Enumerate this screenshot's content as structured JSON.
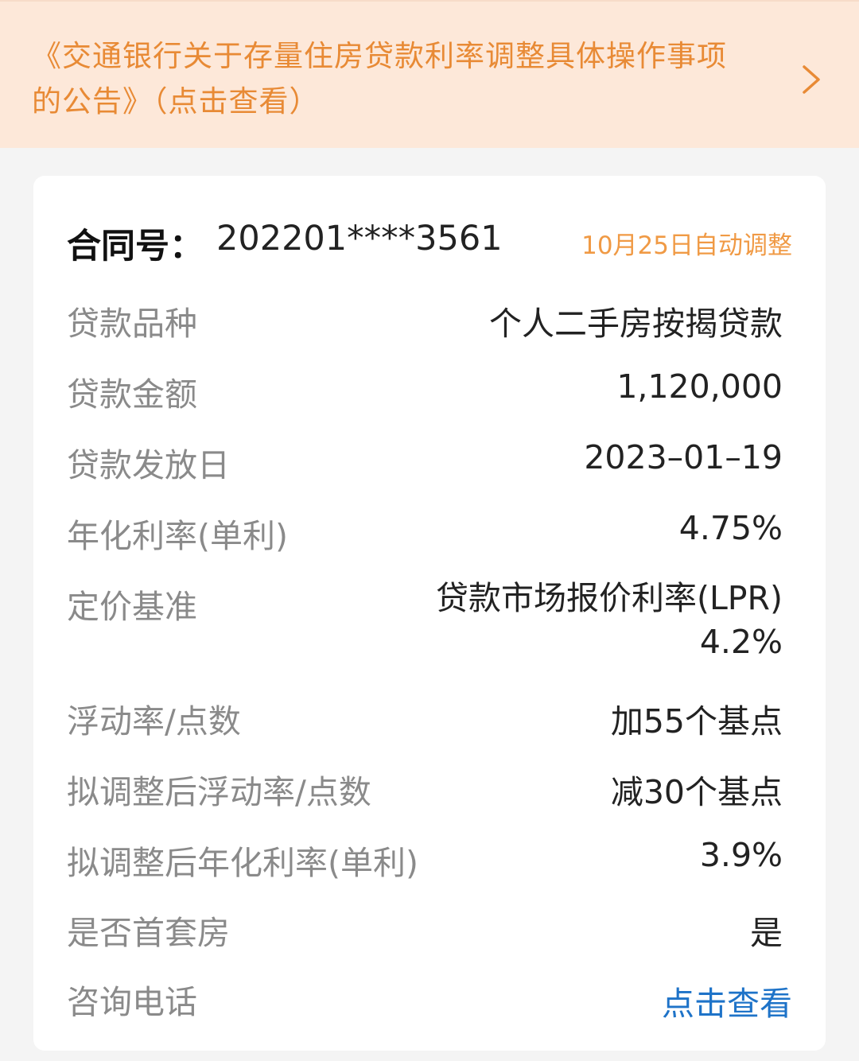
{
  "notice": {
    "text": "《交通银行关于存量住房贷款利率调整具体操作事项的公告》（点击查看）",
    "chevron_icon": "chevron-right-icon",
    "color": "#e88a35",
    "background": "#fde8d9"
  },
  "contract": {
    "label": "合同号：",
    "number": "202201****3561",
    "adjust_note": "10月25日自动调整"
  },
  "details": {
    "loan_type_label": "贷款品种",
    "loan_type_value": "个人二手房按揭贷款",
    "amount_label": "贷款金额",
    "amount_value": "1,120,000",
    "issue_date_label": "贷款发放日",
    "issue_date_value": "2023–01–19",
    "annual_rate_label": "年化利率(单利)",
    "annual_rate_value": "4.75%",
    "pricing_basis_label": "定价基准",
    "pricing_basis_value_line1": "贷款市场报价利率(LPR)",
    "pricing_basis_value_line2": "4.2%",
    "float_label": "浮动率/点数",
    "float_value": "加55个基点",
    "new_float_label": "拟调整后浮动率/点数",
    "new_float_value": "减30个基点",
    "new_rate_label": "拟调整后年化利率(单利)",
    "new_rate_value": "3.9%",
    "first_home_label": "是否首套房",
    "first_home_value": "是",
    "phone_label": "咨询电话",
    "phone_link": "点击查看"
  },
  "colors": {
    "accent_orange": "#f09a45",
    "link_blue": "#1e73c8",
    "label_gray": "#8a8a8a"
  }
}
